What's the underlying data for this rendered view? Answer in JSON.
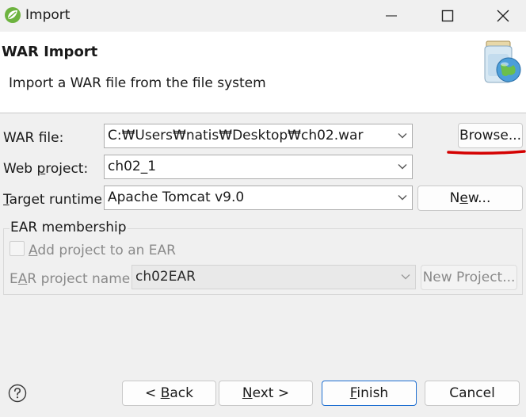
{
  "window": {
    "title": "Import"
  },
  "header": {
    "title": "WAR Import",
    "description": "Import a WAR file from the file system"
  },
  "form": {
    "war_file": {
      "label": "WAR file:",
      "value": "C:₩Users₩natis₩Desktop₩ch02.war",
      "button": "Browse..."
    },
    "web_project": {
      "label_pre": "Web ",
      "label_mnemonic": "p",
      "label_post": "roject:",
      "value": "ch02_1"
    },
    "target_runtime": {
      "label_mnemonic": "T",
      "label_post": "arget runtime:",
      "value": "Apache Tomcat v9.0",
      "button_pre": "N",
      "button_mnemonic": "e",
      "button_post": "w..."
    },
    "ear": {
      "group_label": "EAR membership",
      "checkbox_mnemonic": "A",
      "checkbox_label_post": "dd project to an EAR",
      "checkbox_checked": false,
      "name_label_pre": "E",
      "name_label_mnemonic": "A",
      "name_label_post": "R project name:",
      "name_value": "ch02EAR",
      "new_project_button": "New Project..."
    }
  },
  "footer": {
    "back_pre": "< ",
    "back_mnemonic": "B",
    "back_post": "ack",
    "next_mnemonic": "N",
    "next_post": "ext >",
    "finish_mnemonic": "F",
    "finish_post": "inish",
    "cancel": "Cancel"
  },
  "colors": {
    "annotation": "#d40000",
    "primary_border": "#1f6fd1",
    "spring_green": "#6db33f"
  },
  "icons": [
    "spring-icon",
    "minimize-icon",
    "maximize-icon",
    "close-icon",
    "jar-globe-icon",
    "help-icon",
    "chevron-down-icon"
  ]
}
